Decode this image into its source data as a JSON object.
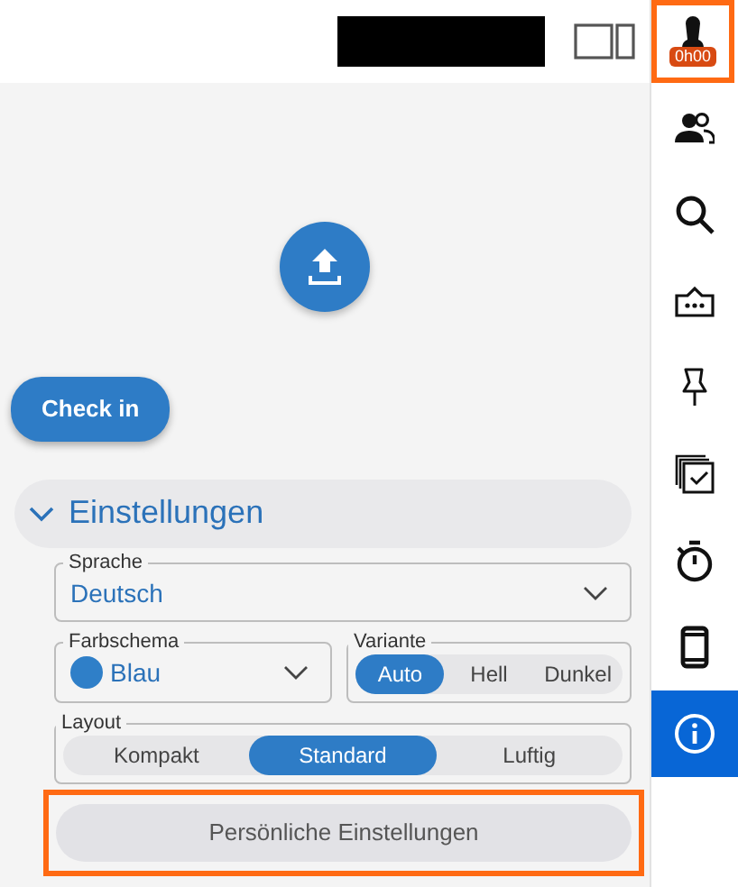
{
  "header": {
    "user_timer": "0h00",
    "user_highlighted": true
  },
  "sidebar": {
    "items": [
      {
        "kind": "people",
        "selected": false
      },
      {
        "kind": "search",
        "selected": false
      },
      {
        "kind": "card",
        "selected": false
      },
      {
        "kind": "pin",
        "selected": false
      },
      {
        "kind": "checklist",
        "selected": false
      },
      {
        "kind": "timer",
        "selected": false
      },
      {
        "kind": "phone",
        "selected": false
      },
      {
        "kind": "info",
        "selected": true
      }
    ]
  },
  "check_in_button": "Check in",
  "settings": {
    "title": "Einstellungen",
    "expanded": true,
    "language": {
      "label": "Sprache",
      "value": "Deutsch"
    },
    "color_scheme": {
      "label": "Farbschema",
      "value": "Blau",
      "color": "#2f7fc8"
    },
    "variant": {
      "label": "Variante",
      "options": [
        {
          "label": "Auto",
          "selected": true
        },
        {
          "label": "Hell",
          "selected": false
        },
        {
          "label": "Dunkel",
          "selected": false
        }
      ]
    },
    "layout": {
      "label": "Layout",
      "options": [
        {
          "label": "Kompakt",
          "selected": false
        },
        {
          "label": "Standard",
          "selected": true
        },
        {
          "label": "Luftig",
          "selected": false
        }
      ]
    },
    "personal_button": {
      "label": "Persönliche Einstellungen",
      "highlighted": true
    }
  }
}
